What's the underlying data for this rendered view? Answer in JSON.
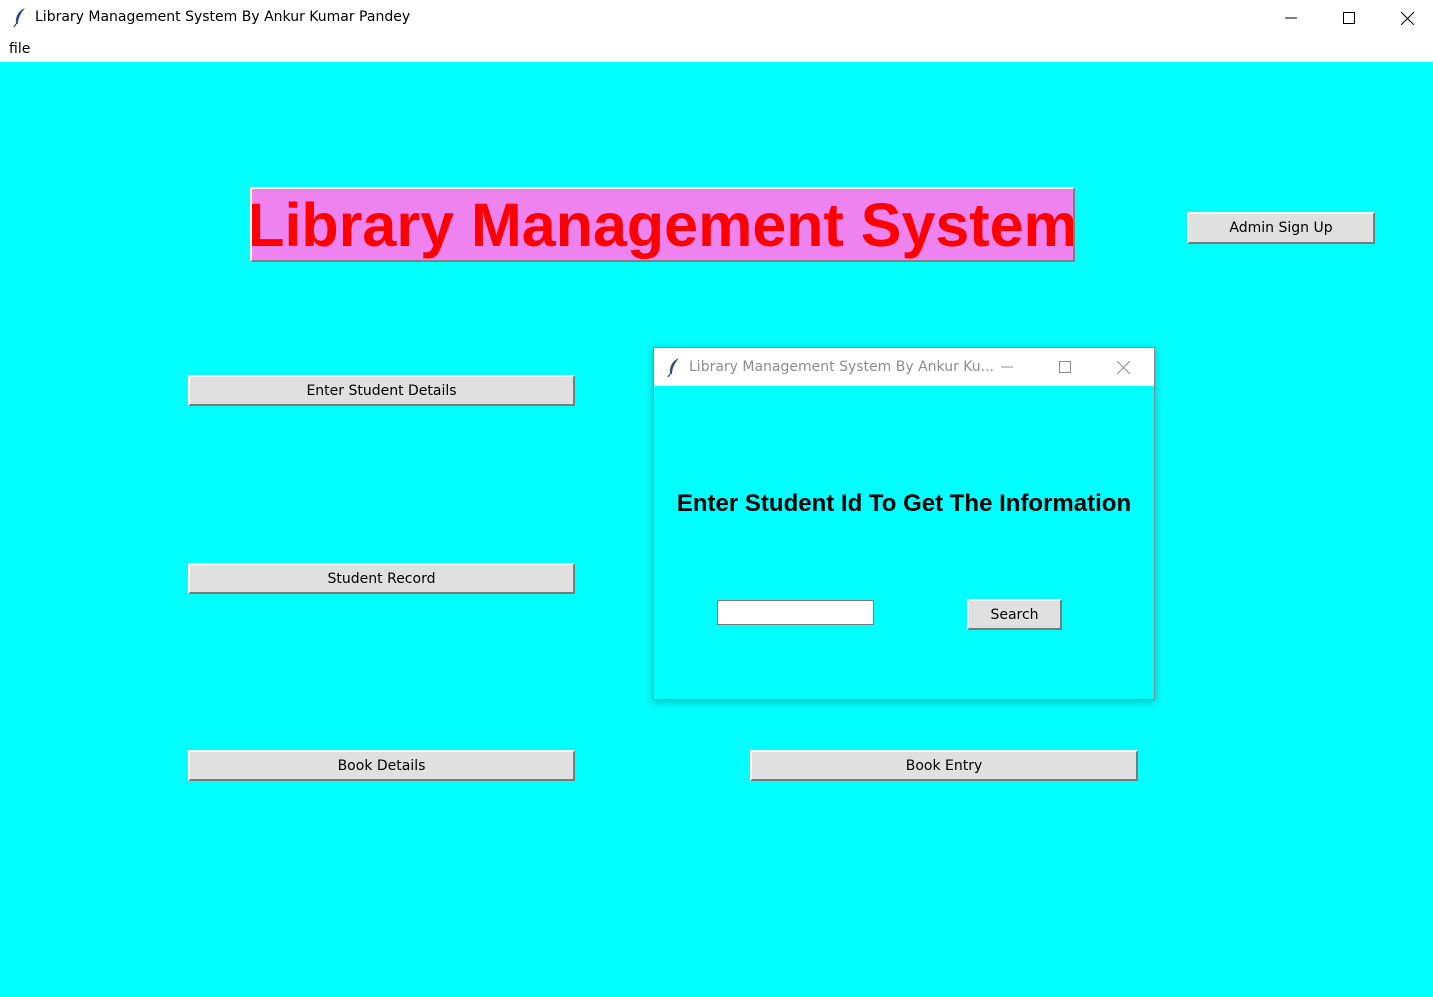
{
  "window": {
    "title": "Library Management System By Ankur Kumar Pandey"
  },
  "menubar": {
    "file_label": "file"
  },
  "main": {
    "heading": "Library Management System",
    "admin_signup_label": "Admin Sign Up",
    "enter_student_details_label": "Enter Student Details",
    "student_record_label": "Student Record",
    "book_details_label": "Book Details",
    "book_entry_label": "Book Entry"
  },
  "popup": {
    "title": "Library Management System By Ankur Ku...",
    "heading": "Enter Student Id To Get The Information",
    "student_id_value": "",
    "search_label": "Search"
  },
  "colors": {
    "background": "#00ffff",
    "heading_bg": "#ee82ee",
    "heading_text": "#ff0000",
    "button_bg": "#e0e0e0"
  },
  "icons": {
    "app": "feather-icon",
    "minimize": "minimize-icon",
    "maximize": "maximize-icon",
    "close": "close-icon"
  }
}
